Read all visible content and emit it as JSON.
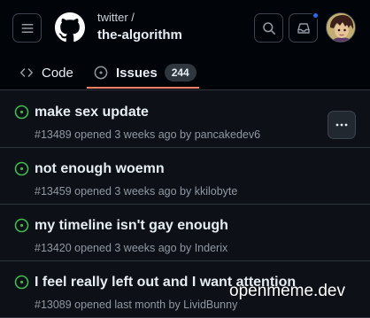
{
  "header": {
    "owner": "twitter /",
    "repo": "the-algorithm",
    "icons": {
      "menu": "hamburger-icon",
      "logo": "github-logo",
      "search": "search-icon",
      "inbox": "inbox-icon"
    }
  },
  "tabs": [
    {
      "label": "Code",
      "icon": "code-icon"
    },
    {
      "label": "Issues",
      "icon": "issue-opened-icon",
      "count": "244",
      "selected": true
    }
  ],
  "accent_colors": {
    "open_issue": "#3fb950",
    "selected_tab_underline": "#f78166",
    "notification_dot": "#1f6feb"
  },
  "issues": [
    {
      "title": "make sex update",
      "meta": "#13489 opened 3 weeks ago by pancakedev6"
    },
    {
      "title": "not enough woemn",
      "meta": "#13459 opened 3 weeks ago by kkilobyte"
    },
    {
      "title": "my timeline isn't gay enough",
      "meta": "#13420 opened 3 weeks ago by Inderix"
    },
    {
      "title": "I feel really left out and I want attention",
      "meta": "#13089 opened last month by LividBunny"
    }
  ],
  "watermark": "openmeme.dev"
}
